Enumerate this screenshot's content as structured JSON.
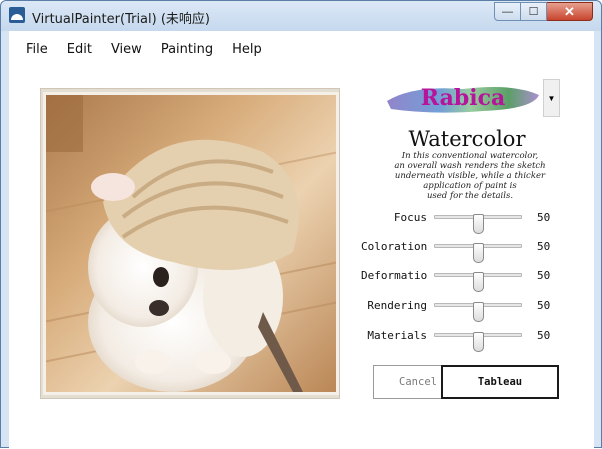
{
  "window": {
    "title": "VirtualPainter(Trial) (未响应)",
    "icon": "app-icon",
    "min_glyph": "—",
    "max_glyph": "☐",
    "close_glyph": "✕"
  },
  "menu": {
    "items": [
      {
        "label": "File"
      },
      {
        "label": "Edit"
      },
      {
        "label": "View"
      },
      {
        "label": "Painting"
      },
      {
        "label": "Help"
      }
    ]
  },
  "style_selector": {
    "selected": "Rabica",
    "dropdown_glyph": "▼"
  },
  "style_info": {
    "title": "Watercolor",
    "description_lines": [
      "In this conventional watercolor,",
      "an overall wash renders the sketch",
      "underneath visible, while a thicker",
      "application of paint is",
      "used for the details."
    ]
  },
  "parameters": [
    {
      "label": "Focus",
      "value": "50",
      "level": 50
    },
    {
      "label": "Coloration",
      "value": "50",
      "level": 50
    },
    {
      "label": "Deformation",
      "value": "50",
      "level": 50
    },
    {
      "label": "Rendering",
      "value": "50",
      "level": 50
    },
    {
      "label": "Materials",
      "value": "50",
      "level": 50
    }
  ],
  "buttons": {
    "cancel": "Cancel",
    "apply": "Tableau"
  },
  "colors": {
    "style_name": "#b5149b",
    "titlebar": "#c6d8ee",
    "close_button": "#c9452e"
  }
}
